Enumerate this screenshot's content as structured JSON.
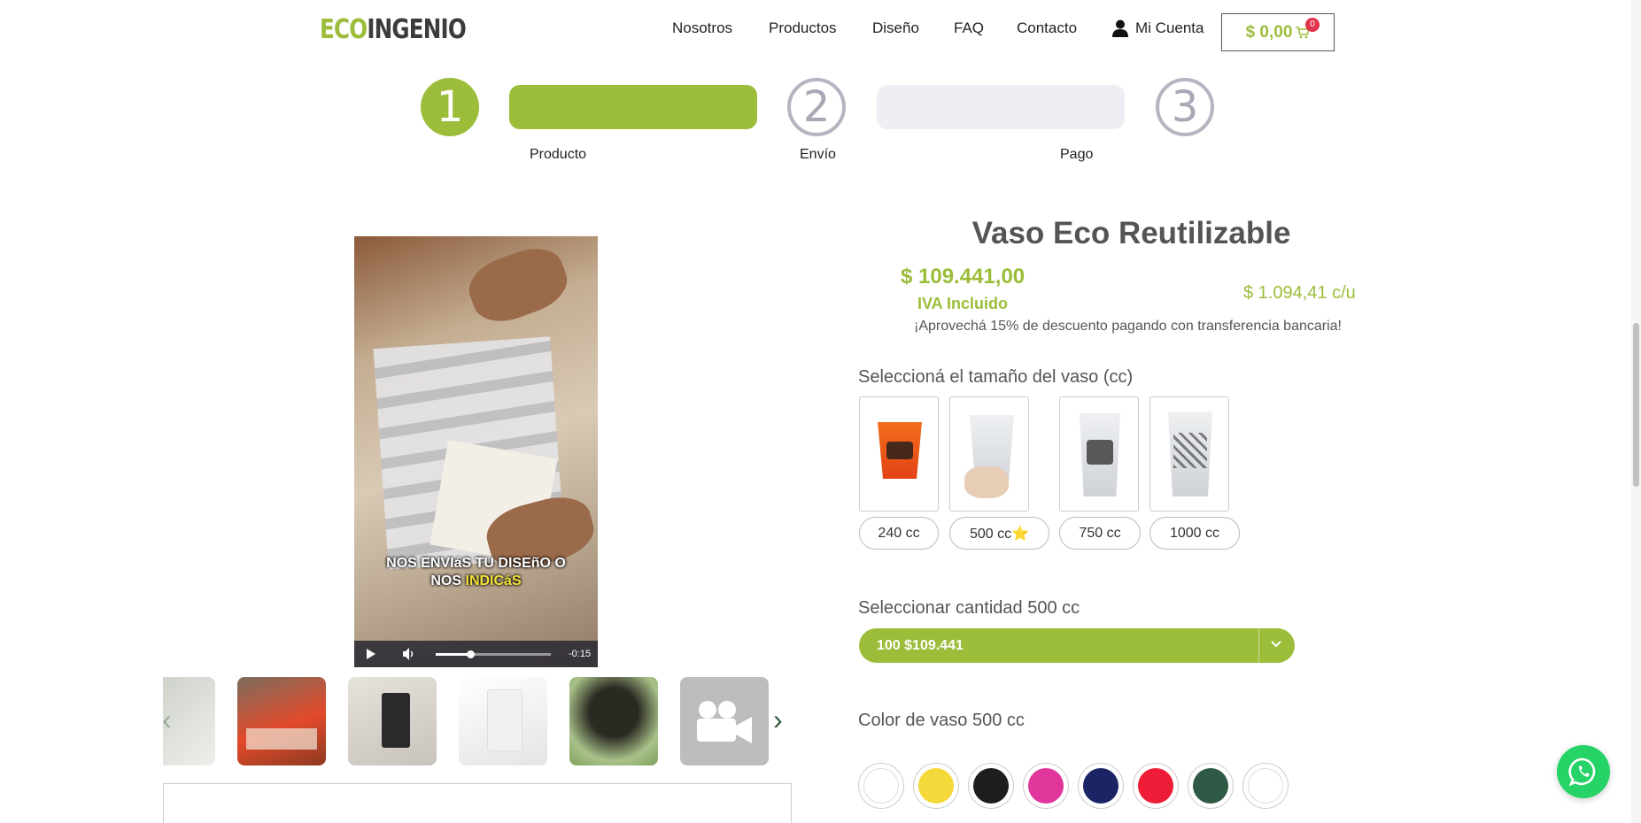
{
  "header": {
    "logo_eco": "ECO",
    "logo_ingenio": "INGENIO",
    "nav": [
      "Nosotros",
      "Productos",
      "Diseño",
      "FAQ",
      "Contacto"
    ],
    "account_label": "Mi Cuenta",
    "account_icon": "user-icon",
    "cart_total": "$ 0,00",
    "cart_count": "0",
    "cart_icon": "cart-icon"
  },
  "steps": {
    "numbers": [
      "1",
      "2",
      "3"
    ],
    "labels": [
      "Producto",
      "Envío",
      "Pago"
    ],
    "active": 1
  },
  "media": {
    "video_caption_line1": "NOS ENVIáS TU DISEñO O",
    "video_caption_line2_a": "NOS ",
    "video_caption_line2_b": "INDICáS",
    "video_time": "-0:15",
    "video_progress": 0.3,
    "thumb_arrow_left": "‹",
    "thumb_arrow_right": "›"
  },
  "product": {
    "title": "Vaso Eco Reutilizable",
    "price": "$ 109.441,00",
    "iva": "IVA Incluido",
    "unit_price": "$ 1.094,41 c/u",
    "discount_note": "¡Aprovechá 15% de descuento pagando con transferencia bancaria!",
    "size_label": "Seleccioná el tamaño del vaso (cc)",
    "sizes": [
      "240 cc",
      "500 cc⭐",
      "750 cc",
      "1000 cc"
    ],
    "quantity_label": "Seleccionar cantidad 500 cc",
    "quantity_value": "100 $109.441",
    "color_label": "Color de vaso 500 cc",
    "colors": [
      "#ffffff",
      "#f5d93a",
      "#1e1e1e",
      "#e0359a",
      "#1c2466",
      "#ee1c36",
      "#2e5a45",
      "#ffffff"
    ]
  },
  "accent": "#9bbd3a"
}
